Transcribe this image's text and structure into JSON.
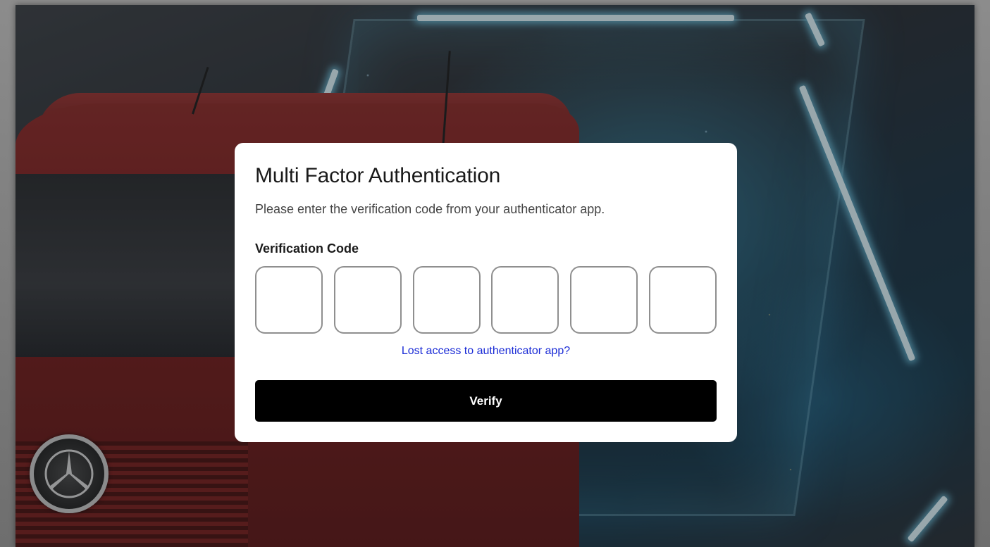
{
  "mfa": {
    "title": "Multi Factor Authentication",
    "description": "Please enter the verification code from your authenticator app.",
    "code_label": "Verification Code",
    "code_digits": [
      "",
      "",
      "",
      "",
      "",
      ""
    ],
    "lost_access_link": "Lost access to authenticator app?",
    "verify_label": "Verify"
  },
  "background": {
    "icons": [
      "mercedes-star-icon"
    ]
  },
  "colors": {
    "link": "#1a2bd6",
    "button_bg": "#000000",
    "button_text": "#ffffff",
    "input_border": "#8f8f8f"
  }
}
